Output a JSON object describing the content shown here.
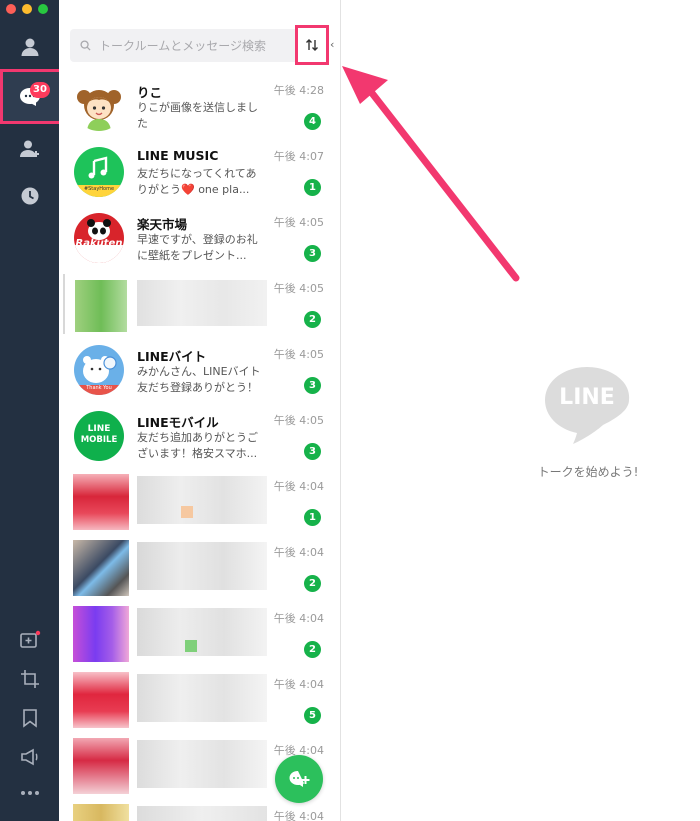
{
  "colors": {
    "nav_bg": "#233041",
    "highlight": "#f2386f",
    "badge_green": "#16b24a",
    "unread_red": "#ff3b5c"
  },
  "nav": {
    "unread_count": "30",
    "icons": [
      "friends-icon",
      "chats-icon",
      "add-friend-icon",
      "timeline-icon",
      "video-call-icon",
      "crop-icon",
      "keep-icon",
      "announcement-icon",
      "more-icon"
    ]
  },
  "search": {
    "placeholder": "トークルームとメッセージ検索",
    "collapse_glyph": "‹"
  },
  "chats": [
    {
      "name": "りこ",
      "preview": "りこが画像を送信しました",
      "time": "午後 4:28",
      "badge": "4"
    },
    {
      "name": "LINE MUSIC",
      "preview": "友だちになってくれてありがとう❤️ one pla...",
      "time": "午後 4:07",
      "badge": "1"
    },
    {
      "name": "楽天市場",
      "preview": "早速ですが、登録のお礼に壁紙をプレゼント...",
      "time": "午後 4:05",
      "badge": "3"
    },
    {
      "name": "",
      "preview": "",
      "time": "午後 4:05",
      "badge": "2"
    },
    {
      "name": "LINEバイト",
      "preview": "みかんさん、LINEバイト友だち登録ありがとう！",
      "time": "午後 4:05",
      "badge": "3"
    },
    {
      "name": "LINEモバイル",
      "preview": "友だち追加ありがとうございます！格安スマホ...",
      "time": "午後 4:05",
      "badge": "3"
    },
    {
      "name": "",
      "preview": "",
      "time": "午後 4:04",
      "badge": "1"
    },
    {
      "name": "",
      "preview": "",
      "time": "午後 4:04",
      "badge": "2"
    },
    {
      "name": "",
      "preview": "",
      "time": "午後 4:04",
      "badge": "2"
    },
    {
      "name": "",
      "preview": "",
      "time": "午後 4:04",
      "badge": "5"
    },
    {
      "name": "",
      "preview": "",
      "time": "午後 4:04",
      "badge": ""
    },
    {
      "name": "",
      "preview": "",
      "time": "午後 4:04",
      "badge": ""
    }
  ],
  "avatars": {
    "rakuten": "Rakuten",
    "line_mobile_1": "LINE",
    "line_mobile_2": "MOBILE",
    "music_label": "#StayHome",
    "baito_label": "Thank You"
  },
  "empty": {
    "logo": "LINE",
    "text": "トークを始めよう!"
  }
}
